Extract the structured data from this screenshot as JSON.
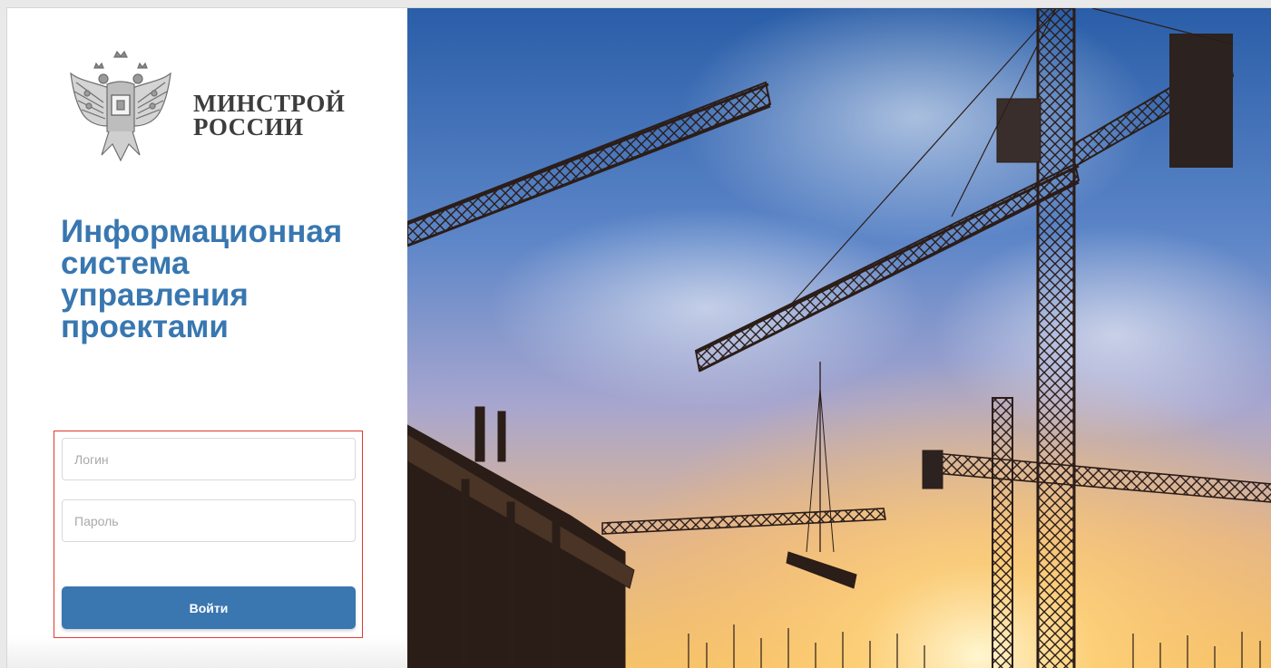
{
  "ministry": {
    "name_line1": "МИНСТРОЙ",
    "name_line2": "РОССИИ",
    "emblem_icon": "coat-of-arms-emblem"
  },
  "system_title": {
    "line1": "Информационная",
    "line2": "система",
    "line3": "управления",
    "line4": "проектами"
  },
  "login_form": {
    "login_placeholder": "Логин",
    "password_placeholder": "Пароль",
    "submit_label": "Войти",
    "highlight_color": "#e0392b"
  },
  "colors": {
    "title": "#3877b0",
    "button": "#3a76b0"
  },
  "hero": {
    "image": "construction-cranes-sunset"
  }
}
